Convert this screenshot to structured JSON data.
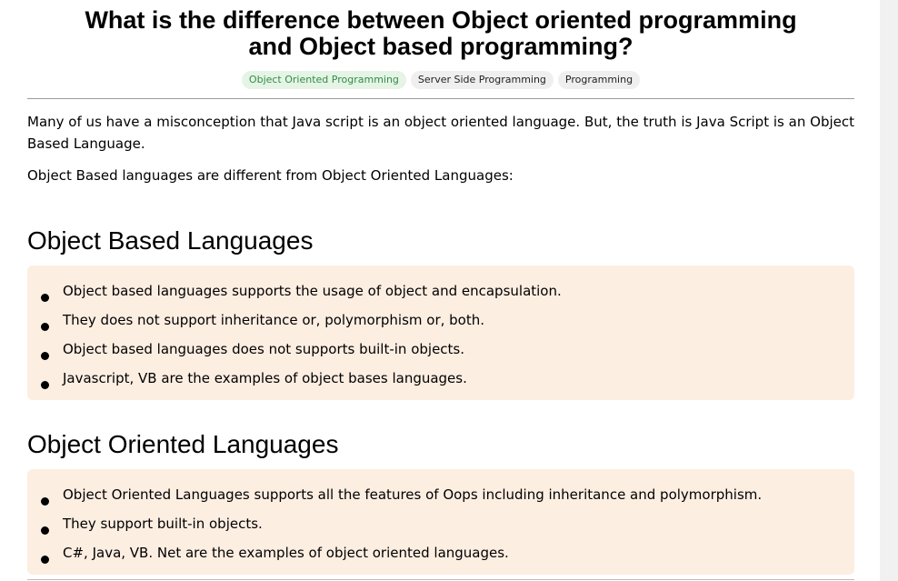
{
  "article": {
    "title": "What is the difference between Object oriented programming and Object based programming?",
    "tags": [
      {
        "label": "Object Oriented Programming",
        "active": true
      },
      {
        "label": "Server Side Programming",
        "active": false
      },
      {
        "label": "Programming",
        "active": false
      }
    ],
    "intro": [
      "Many of us have a misconception that Java script is an object oriented language. But, the truth is Java Script is an Object Based Language.",
      "Object Based languages are different from Object Oriented Languages:"
    ],
    "sections": [
      {
        "heading": "Object Based Languages",
        "items": [
          "Object based languages supports the usage of object and encapsulation.",
          "They does not support inheritance or, polymorphism or, both.",
          "Object based languages does not supports built-in objects.",
          "Javascript, VB are the examples of object bases languages."
        ]
      },
      {
        "heading": "Object Oriented Languages",
        "items": [
          "Object Oriented Languages supports all the features of Oops including inheritance and polymorphism.",
          "They support built-in objects.",
          "C#, Java, VB. Net are the examples of object oriented languages."
        ]
      }
    ]
  },
  "colors": {
    "active_tag_text": "#2f8d46",
    "active_tag_bg": "#e6f4e6",
    "tag_bg": "#efefef",
    "box_bg": "#fdeee2"
  }
}
